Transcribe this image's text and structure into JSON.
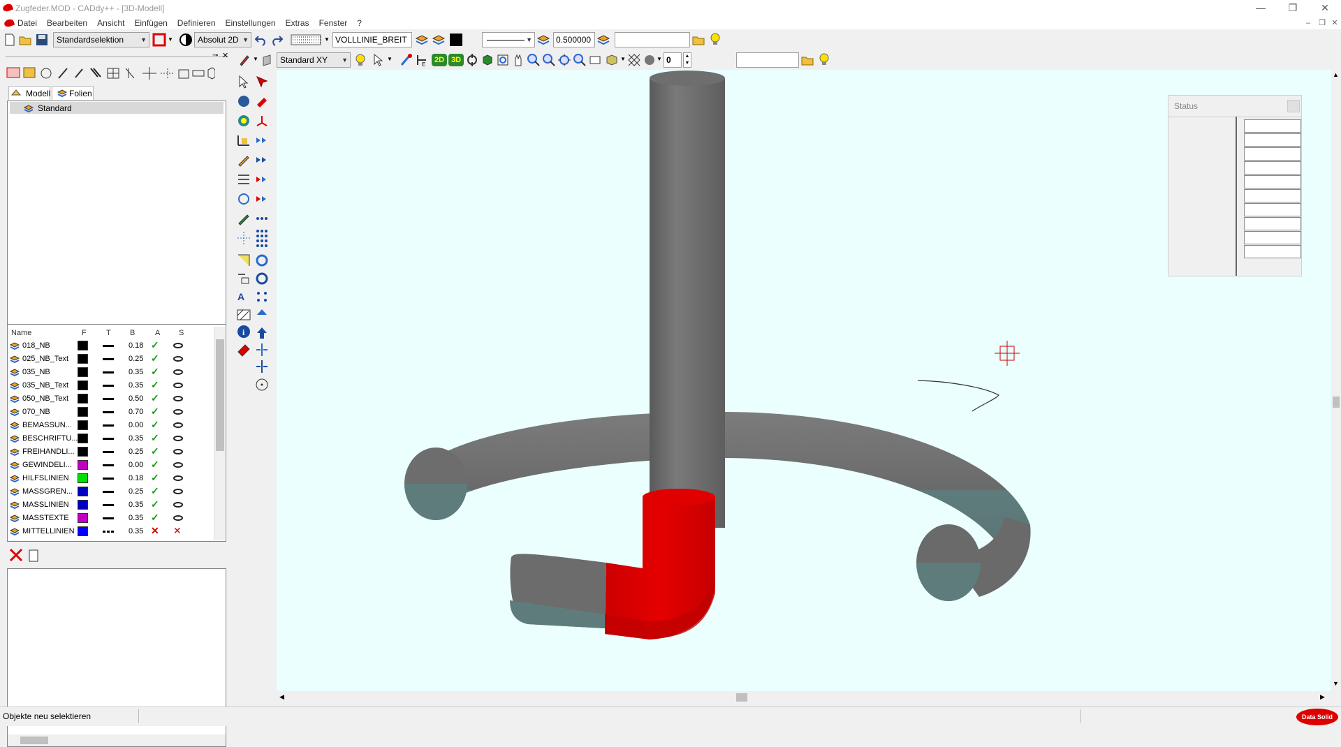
{
  "window": {
    "title": "Zugfeder.MOD  -  CADdy++ - [3D-Modell]",
    "buttons": {
      "minimize": "—",
      "restore": "❐",
      "close": "✕"
    }
  },
  "menu": [
    "Datei",
    "Bearbeiten",
    "Ansicht",
    "Einfügen",
    "Definieren",
    "Einstellungen",
    "Extras",
    "Fenster",
    "?"
  ],
  "toolbar1": {
    "selection_mode": "Standardselektion",
    "coord_mode": "Absolut 2D",
    "line_type": "VOLLLINIE_BREIT",
    "line_width": "0.500000",
    "search_value": ""
  },
  "toolbar2": {
    "view_plane": "Standard XY",
    "layer_number": "0",
    "label_2d": "2D",
    "label_3d": "3D",
    "field_value": ""
  },
  "left_panel": {
    "tabs": [
      "Modell",
      "Folien"
    ],
    "active_tab": "Folien",
    "tree": [
      "Standard"
    ],
    "columns": [
      "Name",
      "F",
      "T",
      "B",
      "A",
      "S"
    ],
    "layers": [
      {
        "name": "018_NB",
        "color": "#000000",
        "line": "solid",
        "width": "0.18",
        "active": true,
        "visible": true
      },
      {
        "name": "025_NB_Text",
        "color": "#000000",
        "line": "solid",
        "width": "0.25",
        "active": true,
        "visible": true
      },
      {
        "name": "035_NB",
        "color": "#000000",
        "line": "solid",
        "width": "0.35",
        "active": true,
        "visible": true
      },
      {
        "name": "035_NB_Text",
        "color": "#000000",
        "line": "solid",
        "width": "0.35",
        "active": true,
        "visible": true
      },
      {
        "name": "050_NB_Text",
        "color": "#000000",
        "line": "solid",
        "width": "0.50",
        "active": true,
        "visible": true
      },
      {
        "name": "070_NB",
        "color": "#000000",
        "line": "solid",
        "width": "0.70",
        "active": true,
        "visible": true
      },
      {
        "name": "BEMASSUN...",
        "color": "#000000",
        "line": "solid",
        "width": "0.00",
        "active": true,
        "visible": true
      },
      {
        "name": "BESCHRIFTU...",
        "color": "#000000",
        "line": "solid",
        "width": "0.35",
        "active": true,
        "visible": true
      },
      {
        "name": "FREIHANDLI...",
        "color": "#000000",
        "line": "solid",
        "width": "0.25",
        "active": true,
        "visible": true
      },
      {
        "name": "GEWINDELI...",
        "color": "#c000c0",
        "line": "solid",
        "width": "0.00",
        "active": true,
        "visible": true
      },
      {
        "name": "HILFSLINIEN",
        "color": "#00e000",
        "line": "solid",
        "width": "0.18",
        "active": true,
        "visible": true
      },
      {
        "name": "MASSGREN...",
        "color": "#0000c0",
        "line": "solid",
        "width": "0.25",
        "active": true,
        "visible": true
      },
      {
        "name": "MASSLINIEN",
        "color": "#0000c0",
        "line": "solid",
        "width": "0.35",
        "active": true,
        "visible": true
      },
      {
        "name": "MASSTEXTE",
        "color": "#c000c0",
        "line": "solid",
        "width": "0.35",
        "active": true,
        "visible": true
      },
      {
        "name": "MITTELLINIEN",
        "color": "#0000ff",
        "line": "dash",
        "width": "0.35",
        "active": false,
        "visible": false
      }
    ]
  },
  "status_panel": {
    "title": "Status",
    "rows": 10
  },
  "statusbar": {
    "message": "Objekte neu selektieren",
    "brand": "Data Solid"
  },
  "colors": {
    "accent": "#d00000",
    "viewport_bg": "#eafffe",
    "model_gray": "#6f6f6f",
    "model_red": "#e00000"
  }
}
